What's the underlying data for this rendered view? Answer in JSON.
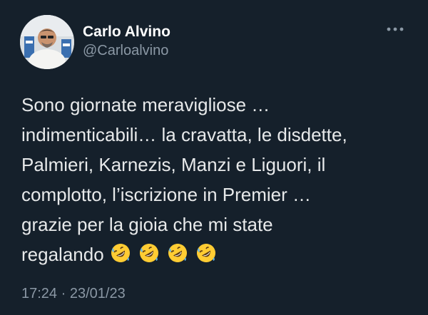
{
  "tweet": {
    "author_name": "Carlo Alvino",
    "author_handle": "@Carloalvino",
    "more_icon": "more-horizontal-icon",
    "text_lines": [
      "Sono giornate meravigliose …",
      "indimenticabili… la cravatta, le disdette,",
      "Palmieri, Karnezis, Manzi e Liguori, il",
      "complotto, l’iscrizione in Premier …",
      "grazie per la gioia che mi state",
      "regalando"
    ],
    "emojis": [
      "rolling-on-floor-laughing-icon",
      "rolling-on-floor-laughing-icon",
      "rolling-on-floor-laughing-icon",
      "rolling-on-floor-laughing-icon"
    ],
    "time": "17:24",
    "separator": "·",
    "date": "23/01/23"
  },
  "colors": {
    "background": "#15202b",
    "text": "#e7e9ea",
    "muted": "#8b98a5"
  }
}
